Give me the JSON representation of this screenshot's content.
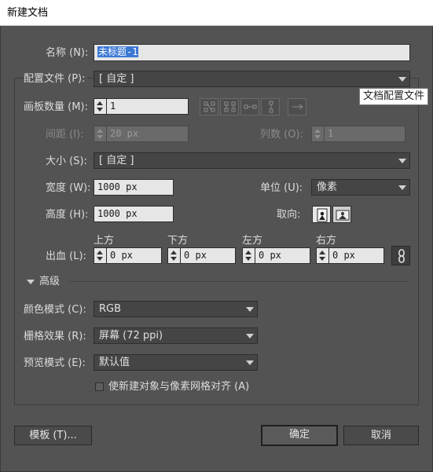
{
  "window": {
    "title": "新建文档"
  },
  "name_field": {
    "label": "名称 (N):",
    "value": "未标题-1"
  },
  "profile": {
    "label": "配置文件 (P):",
    "value": "[ 自定 ]",
    "tooltip": "文档配置文件"
  },
  "artboards": {
    "label": "画板数量 (M):",
    "value": "1",
    "layout_icons": [
      "grid-by-row-icon",
      "grid-by-column-icon",
      "arrange-by-row-icon",
      "arrange-by-column-icon",
      "right-to-left-icon"
    ]
  },
  "spacing": {
    "label": "间距 (I):",
    "value": "20 px"
  },
  "columns": {
    "label": "列数 (O):",
    "value": "1"
  },
  "size": {
    "label": "大小 (S):",
    "value": "[ 自定 ]"
  },
  "width": {
    "label": "宽度 (W):",
    "value": "1000 px"
  },
  "units": {
    "label": "单位 (U):",
    "value": "像素"
  },
  "height": {
    "label": "高度 (H):",
    "value": "1000 px"
  },
  "orientation": {
    "label": "取向:"
  },
  "bleed": {
    "label": "出血 (L):",
    "top_label": "上方",
    "top_value": "0 px",
    "bottom_label": "下方",
    "bottom_value": "0 px",
    "left_label": "左方",
    "left_value": "0 px",
    "right_label": "右方",
    "right_value": "0 px"
  },
  "advanced": {
    "label": "高级"
  },
  "color_mode": {
    "label": "颜色模式 (C):",
    "value": "RGB"
  },
  "raster": {
    "label": "栅格效果 (R):",
    "value": "屏幕 (72 ppi)"
  },
  "preview": {
    "label": "预览模式 (E):",
    "value": "默认值"
  },
  "align_pixel": {
    "label": "使新建对象与像素网格对齐 (A)",
    "checked": false
  },
  "buttons": {
    "templates": "模板 (T)...",
    "ok": "确定",
    "cancel": "取消"
  }
}
